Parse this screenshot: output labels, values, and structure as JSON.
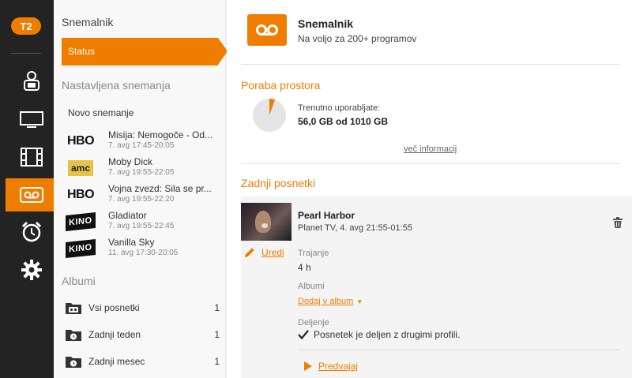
{
  "brand": {
    "logo_text": "T2",
    "accent": "#ef7d00"
  },
  "rail": {
    "items": [
      {
        "name": "profile-icon"
      },
      {
        "name": "tv-icon"
      },
      {
        "name": "film-icon"
      },
      {
        "name": "recorder-icon",
        "active": true
      },
      {
        "name": "alarm-clock-icon"
      },
      {
        "name": "gear-icon"
      }
    ]
  },
  "sidebar": {
    "title": "Snemalnik",
    "status_label": "Status",
    "scheduled_title": "Nastavljena snemanja",
    "new_recording": "Novo snemanje",
    "recordings": [
      {
        "channel": "HBO",
        "title": "Misija: Nemogoče - Od...",
        "time": "7. avg 17:45-20:05"
      },
      {
        "channel": "amc",
        "title": "Moby Dick",
        "time": "7. avg 19:55-22:05"
      },
      {
        "channel": "HBO",
        "title": "Vojna zvezd: Sila se pr...",
        "time": "7. avg 19:55-22:20"
      },
      {
        "channel": "KINO",
        "title": "Gladiator",
        "time": "7. avg 19:55-22:45"
      },
      {
        "channel": "KINO",
        "title": "Vanilla Sky",
        "time": "11. avg 17:30-20:05"
      }
    ],
    "albums_title": "Albumi",
    "albums": [
      {
        "label": "Vsi posnetki",
        "count": "1"
      },
      {
        "label": "Zadnji teden",
        "count": "1"
      },
      {
        "label": "Zadnji mesec",
        "count": "1"
      }
    ]
  },
  "main": {
    "header": {
      "title": "Snemalnik",
      "subtitle": "Na voljo za 200+ programov"
    },
    "storage": {
      "title": "Poraba prostora",
      "label": "Trenutno uporabljate:",
      "value": "56,0 GB od 1010 GB",
      "used_fraction": 0.055,
      "more_link": "več informacij"
    },
    "latest": {
      "title": "Zadnji posnetki",
      "item": {
        "title": "Pearl Harbor",
        "subtitle": "Planet TV, 4. avg 21:55-01:55",
        "edit_label": "Uredi",
        "duration_label": "Trajanje",
        "duration_value": "4 h",
        "albums_label": "Albumi",
        "add_album_link": "Dodaj v album",
        "sharing_label": "Deljenje",
        "sharing_value": "Posnetek je deljen z drugimi profili.",
        "play_label": "Predvajaj"
      }
    }
  }
}
